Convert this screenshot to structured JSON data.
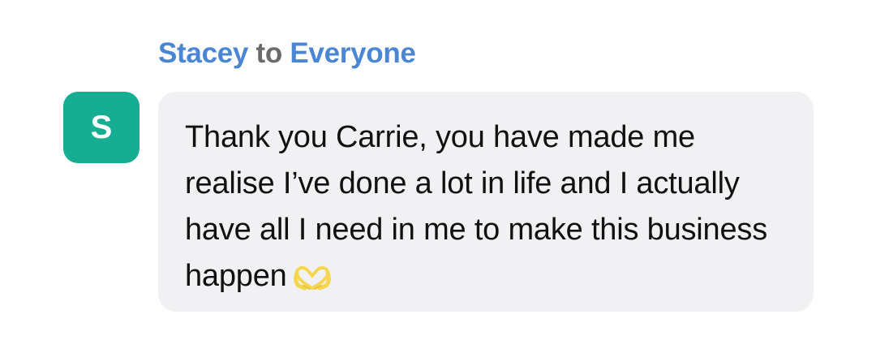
{
  "message": {
    "sender": "Stacey",
    "connector": "to",
    "recipient": "Everyone",
    "avatar_initial": "S",
    "text": "Thank you Carrie, you have made me realise I’ve done a lot in life and I actually have all I need in me to make this business happen",
    "emoji": "heart-hands-icon"
  },
  "colors": {
    "name_accent": "#4a86d4",
    "avatar_bg": "#16ae92",
    "bubble_bg": "#f1f1f3"
  }
}
